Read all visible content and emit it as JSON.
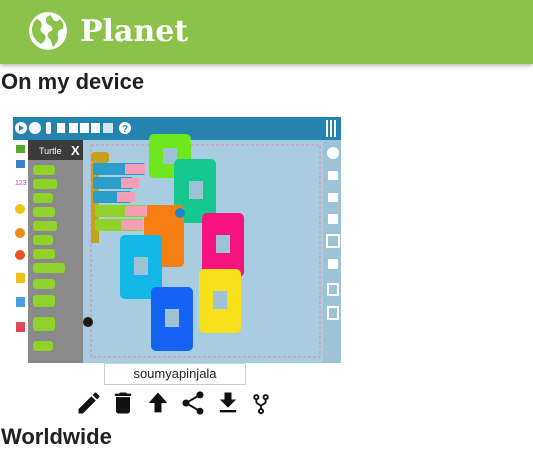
{
  "header": {
    "title": "Planet",
    "logo_icon": "globe-icon",
    "color": "#8bc34a"
  },
  "sections": {
    "local_title": "On my device",
    "global_title": "Worldwide"
  },
  "project": {
    "thumbnail_label": "Turtle",
    "owner": "soumyapinjala",
    "actions": [
      "edit-icon",
      "delete-icon",
      "upload-icon",
      "share-icon",
      "download-icon",
      "merge-icon"
    ]
  }
}
